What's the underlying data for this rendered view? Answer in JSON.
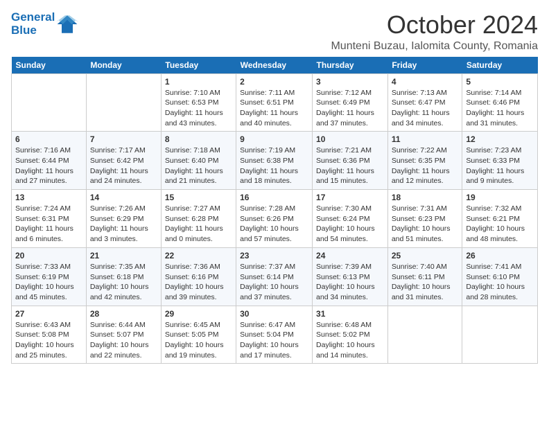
{
  "logo": {
    "line1": "General",
    "line2": "Blue"
  },
  "title": "October 2024",
  "location": "Munteni Buzau, Ialomita County, Romania",
  "days_of_week": [
    "Sunday",
    "Monday",
    "Tuesday",
    "Wednesday",
    "Thursday",
    "Friday",
    "Saturday"
  ],
  "weeks": [
    [
      {
        "day": "",
        "sunrise": "",
        "sunset": "",
        "daylight": ""
      },
      {
        "day": "",
        "sunrise": "",
        "sunset": "",
        "daylight": ""
      },
      {
        "day": "1",
        "sunrise": "Sunrise: 7:10 AM",
        "sunset": "Sunset: 6:53 PM",
        "daylight": "Daylight: 11 hours and 43 minutes."
      },
      {
        "day": "2",
        "sunrise": "Sunrise: 7:11 AM",
        "sunset": "Sunset: 6:51 PM",
        "daylight": "Daylight: 11 hours and 40 minutes."
      },
      {
        "day": "3",
        "sunrise": "Sunrise: 7:12 AM",
        "sunset": "Sunset: 6:49 PM",
        "daylight": "Daylight: 11 hours and 37 minutes."
      },
      {
        "day": "4",
        "sunrise": "Sunrise: 7:13 AM",
        "sunset": "Sunset: 6:47 PM",
        "daylight": "Daylight: 11 hours and 34 minutes."
      },
      {
        "day": "5",
        "sunrise": "Sunrise: 7:14 AM",
        "sunset": "Sunset: 6:46 PM",
        "daylight": "Daylight: 11 hours and 31 minutes."
      }
    ],
    [
      {
        "day": "6",
        "sunrise": "Sunrise: 7:16 AM",
        "sunset": "Sunset: 6:44 PM",
        "daylight": "Daylight: 11 hours and 27 minutes."
      },
      {
        "day": "7",
        "sunrise": "Sunrise: 7:17 AM",
        "sunset": "Sunset: 6:42 PM",
        "daylight": "Daylight: 11 hours and 24 minutes."
      },
      {
        "day": "8",
        "sunrise": "Sunrise: 7:18 AM",
        "sunset": "Sunset: 6:40 PM",
        "daylight": "Daylight: 11 hours and 21 minutes."
      },
      {
        "day": "9",
        "sunrise": "Sunrise: 7:19 AM",
        "sunset": "Sunset: 6:38 PM",
        "daylight": "Daylight: 11 hours and 18 minutes."
      },
      {
        "day": "10",
        "sunrise": "Sunrise: 7:21 AM",
        "sunset": "Sunset: 6:36 PM",
        "daylight": "Daylight: 11 hours and 15 minutes."
      },
      {
        "day": "11",
        "sunrise": "Sunrise: 7:22 AM",
        "sunset": "Sunset: 6:35 PM",
        "daylight": "Daylight: 11 hours and 12 minutes."
      },
      {
        "day": "12",
        "sunrise": "Sunrise: 7:23 AM",
        "sunset": "Sunset: 6:33 PM",
        "daylight": "Daylight: 11 hours and 9 minutes."
      }
    ],
    [
      {
        "day": "13",
        "sunrise": "Sunrise: 7:24 AM",
        "sunset": "Sunset: 6:31 PM",
        "daylight": "Daylight: 11 hours and 6 minutes."
      },
      {
        "day": "14",
        "sunrise": "Sunrise: 7:26 AM",
        "sunset": "Sunset: 6:29 PM",
        "daylight": "Daylight: 11 hours and 3 minutes."
      },
      {
        "day": "15",
        "sunrise": "Sunrise: 7:27 AM",
        "sunset": "Sunset: 6:28 PM",
        "daylight": "Daylight: 11 hours and 0 minutes."
      },
      {
        "day": "16",
        "sunrise": "Sunrise: 7:28 AM",
        "sunset": "Sunset: 6:26 PM",
        "daylight": "Daylight: 10 hours and 57 minutes."
      },
      {
        "day": "17",
        "sunrise": "Sunrise: 7:30 AM",
        "sunset": "Sunset: 6:24 PM",
        "daylight": "Daylight: 10 hours and 54 minutes."
      },
      {
        "day": "18",
        "sunrise": "Sunrise: 7:31 AM",
        "sunset": "Sunset: 6:23 PM",
        "daylight": "Daylight: 10 hours and 51 minutes."
      },
      {
        "day": "19",
        "sunrise": "Sunrise: 7:32 AM",
        "sunset": "Sunset: 6:21 PM",
        "daylight": "Daylight: 10 hours and 48 minutes."
      }
    ],
    [
      {
        "day": "20",
        "sunrise": "Sunrise: 7:33 AM",
        "sunset": "Sunset: 6:19 PM",
        "daylight": "Daylight: 10 hours and 45 minutes."
      },
      {
        "day": "21",
        "sunrise": "Sunrise: 7:35 AM",
        "sunset": "Sunset: 6:18 PM",
        "daylight": "Daylight: 10 hours and 42 minutes."
      },
      {
        "day": "22",
        "sunrise": "Sunrise: 7:36 AM",
        "sunset": "Sunset: 6:16 PM",
        "daylight": "Daylight: 10 hours and 39 minutes."
      },
      {
        "day": "23",
        "sunrise": "Sunrise: 7:37 AM",
        "sunset": "Sunset: 6:14 PM",
        "daylight": "Daylight: 10 hours and 37 minutes."
      },
      {
        "day": "24",
        "sunrise": "Sunrise: 7:39 AM",
        "sunset": "Sunset: 6:13 PM",
        "daylight": "Daylight: 10 hours and 34 minutes."
      },
      {
        "day": "25",
        "sunrise": "Sunrise: 7:40 AM",
        "sunset": "Sunset: 6:11 PM",
        "daylight": "Daylight: 10 hours and 31 minutes."
      },
      {
        "day": "26",
        "sunrise": "Sunrise: 7:41 AM",
        "sunset": "Sunset: 6:10 PM",
        "daylight": "Daylight: 10 hours and 28 minutes."
      }
    ],
    [
      {
        "day": "27",
        "sunrise": "Sunrise: 6:43 AM",
        "sunset": "Sunset: 5:08 PM",
        "daylight": "Daylight: 10 hours and 25 minutes."
      },
      {
        "day": "28",
        "sunrise": "Sunrise: 6:44 AM",
        "sunset": "Sunset: 5:07 PM",
        "daylight": "Daylight: 10 hours and 22 minutes."
      },
      {
        "day": "29",
        "sunrise": "Sunrise: 6:45 AM",
        "sunset": "Sunset: 5:05 PM",
        "daylight": "Daylight: 10 hours and 19 minutes."
      },
      {
        "day": "30",
        "sunrise": "Sunrise: 6:47 AM",
        "sunset": "Sunset: 5:04 PM",
        "daylight": "Daylight: 10 hours and 17 minutes."
      },
      {
        "day": "31",
        "sunrise": "Sunrise: 6:48 AM",
        "sunset": "Sunset: 5:02 PM",
        "daylight": "Daylight: 10 hours and 14 minutes."
      },
      {
        "day": "",
        "sunrise": "",
        "sunset": "",
        "daylight": ""
      },
      {
        "day": "",
        "sunrise": "",
        "sunset": "",
        "daylight": ""
      }
    ]
  ]
}
